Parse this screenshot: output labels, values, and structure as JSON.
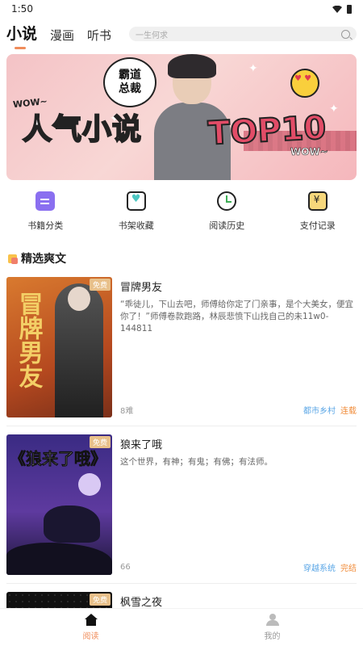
{
  "status_bar": {
    "time": "1:50"
  },
  "top_nav": {
    "tabs": [
      {
        "label": "小说",
        "active": true
      },
      {
        "label": "漫画",
        "active": false
      },
      {
        "label": "听书",
        "active": false
      }
    ],
    "search_placeholder": "一生何求"
  },
  "banner": {
    "bubble_line1": "霸道",
    "bubble_line2": "总裁",
    "title": "人气小说",
    "top10": "TOP10",
    "wow_left": "WOW~",
    "wow_right": "WOW~"
  },
  "shortcuts": [
    {
      "label": "书籍分类",
      "icon": "category-icon"
    },
    {
      "label": "书架收藏",
      "icon": "bookshelf-icon"
    },
    {
      "label": "阅读历史",
      "icon": "history-icon"
    },
    {
      "label": "支付记录",
      "icon": "payment-icon"
    }
  ],
  "section": {
    "title": "精选爽文"
  },
  "books": [
    {
      "title": "冒牌男友",
      "cover_text": "冒牌男友",
      "badge": "免费",
      "description": "“乖徒儿，下山去吧，师傅给你定了门亲事，是个大美女，便宜你了！”师傅卷款跑路，林辰悲愤下山找自己的未11w0-144811",
      "count": "8难",
      "genre": "都市乡村",
      "status": "连载"
    },
    {
      "title": "狼来了哦",
      "cover_text": "《狼来了哦》",
      "badge": "免费",
      "description": "这个世界，有神；有鬼；有佛；有法师。",
      "count": "66",
      "genre": "穿越系统",
      "status": "完结"
    },
    {
      "title": "枫雪之夜",
      "badge": "免费"
    }
  ],
  "bottom_nav": {
    "items": [
      {
        "label": "阅读",
        "active": true
      },
      {
        "label": "我的",
        "active": false
      }
    ]
  },
  "colors": {
    "accent": "#f08c5a",
    "genre_tag": "#5aa6e6",
    "status_tag": "#f08c3a"
  }
}
